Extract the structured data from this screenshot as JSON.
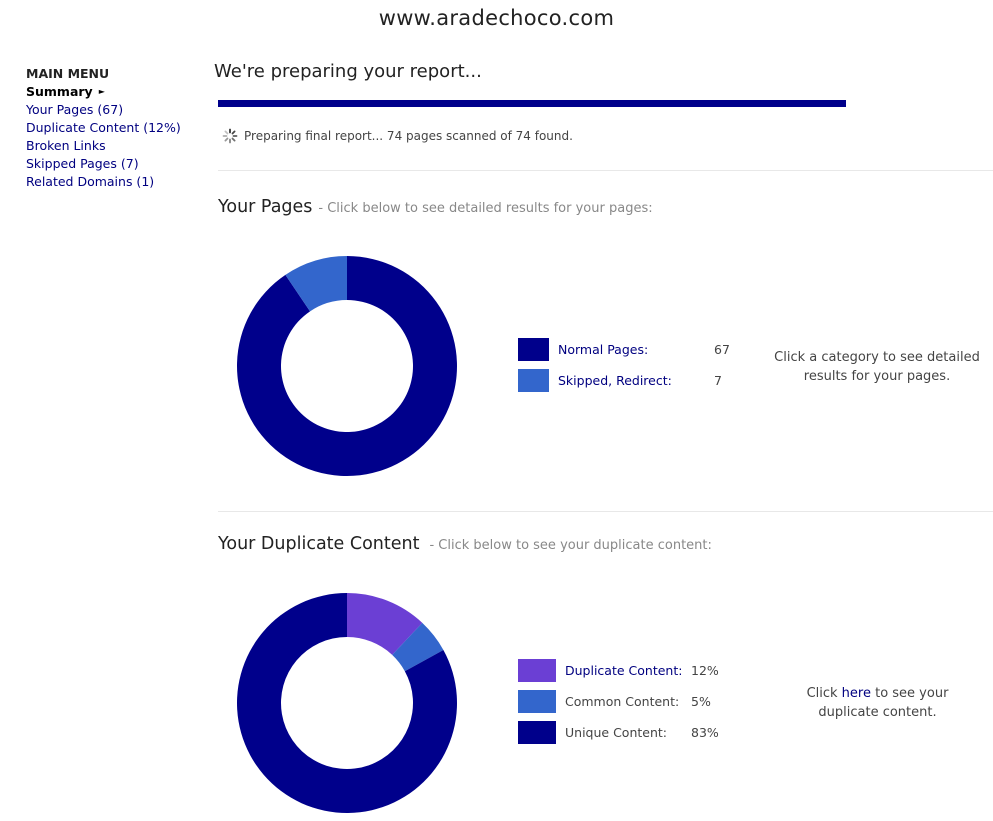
{
  "site": {
    "title": "www.aradechoco.com"
  },
  "sidebar": {
    "heading": "MAIN MENU",
    "items": [
      {
        "label": "Summary"
      },
      {
        "label": "Your Pages (67)"
      },
      {
        "label": "Duplicate Content (12%)"
      },
      {
        "label": "Broken Links"
      },
      {
        "label": "Skipped Pages (7)"
      },
      {
        "label": "Related Domains (1)"
      }
    ]
  },
  "report": {
    "title": "We're preparing your report...",
    "progress_percent": 100,
    "status": "Preparing final report... 74 pages scanned of 74 found."
  },
  "pages_section": {
    "title": "Your Pages",
    "subtitle": "-  Click below to see detailed results for your pages:",
    "legend": [
      {
        "label": "Normal Pages:",
        "value": "67",
        "color": "#00008b"
      },
      {
        "label": "Skipped, Redirect:",
        "value": "7",
        "color": "#3366cc"
      }
    ],
    "hint": "Click a category to see detailed results for your pages."
  },
  "duplicate_section": {
    "title": "Your Duplicate Content",
    "subtitle": "-  Click below to see your duplicate content:",
    "legend": [
      {
        "label": "Duplicate Content:",
        "value": "12%",
        "color": "#6b3fd4"
      },
      {
        "label": "Common Content:",
        "value": "5%",
        "color": "#3366cc"
      },
      {
        "label": "Unique Content:",
        "value": "83%",
        "color": "#00008b"
      }
    ],
    "hint_before": "Click ",
    "hint_link": "here",
    "hint_after": " to see your duplicate content."
  },
  "chart_data": [
    {
      "type": "pie",
      "categories": [
        "Normal Pages",
        "Skipped, Redirect"
      ],
      "values": [
        67,
        7
      ],
      "colors": [
        "#00008b",
        "#3366cc"
      ]
    },
    {
      "type": "pie",
      "categories": [
        "Duplicate Content",
        "Common Content",
        "Unique Content"
      ],
      "values": [
        12,
        5,
        83
      ],
      "colors": [
        "#6b3fd4",
        "#3366cc",
        "#00008b"
      ]
    }
  ]
}
